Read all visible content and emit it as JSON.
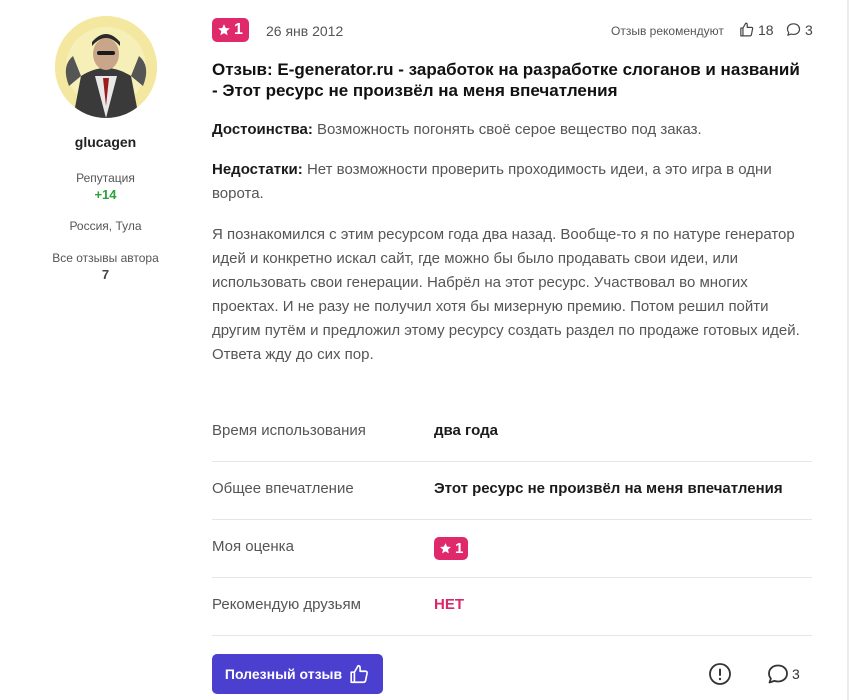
{
  "author": {
    "username": "glucagen",
    "reputation_label": "Репутация",
    "reputation_value": "+14",
    "location": "Россия, Тула",
    "all_reviews_label": "Все отзывы автора",
    "all_reviews_count": "7"
  },
  "review": {
    "rating": "1",
    "date": "26 янв 2012",
    "recommend_label": "Отзыв рекомендуют",
    "likes_count": "18",
    "comments_count": "3",
    "title": "Отзыв: E-generator.ru - заработок на разработке слоганов и названий - Этот ресурс не произвёл на меня впечатления",
    "pros_label": "Достоинства:",
    "pros_text": "Возможность погонять своё серое вещество под заказ.",
    "cons_label": "Недостатки:",
    "cons_text": "Нет возможности проверить проходимость идеи, а это игра в одни ворота.",
    "body": "Я познакомился с этим ресурсом года два назад. Вообще-то я по натуре генератор идей и конкретно искал сайт, где можно бы было продавать свои идеи, или использовать свои генерации. Набрёл на этот ресурс. Участвовал во многих проектах. И не разу не получил хотя бы мизерную премию. Потом решил пойти другим путём и предложил этому ресурсу создать раздел по продаже готовых идей. Ответа жду до сих пор."
  },
  "details": {
    "usage_label": "Время использования",
    "usage_value": "два года",
    "impression_label": "Общее впечатление",
    "impression_value": "Этот ресурс не произвёл на меня впечатления",
    "rating_label": "Моя оценка",
    "rating_value": "1",
    "recommend_label": "Рекомендую друзьям",
    "recommend_value": "НЕТ"
  },
  "actions": {
    "helpful_label": "Полезный отзыв",
    "comments_count": "3"
  },
  "colors": {
    "accent_pink": "#e0296b",
    "button_purple": "#4a3fcf",
    "reputation_green": "#2aa33a"
  },
  "icons": [
    "star-icon",
    "thumbs-up-icon",
    "comment-icon",
    "report-icon"
  ]
}
